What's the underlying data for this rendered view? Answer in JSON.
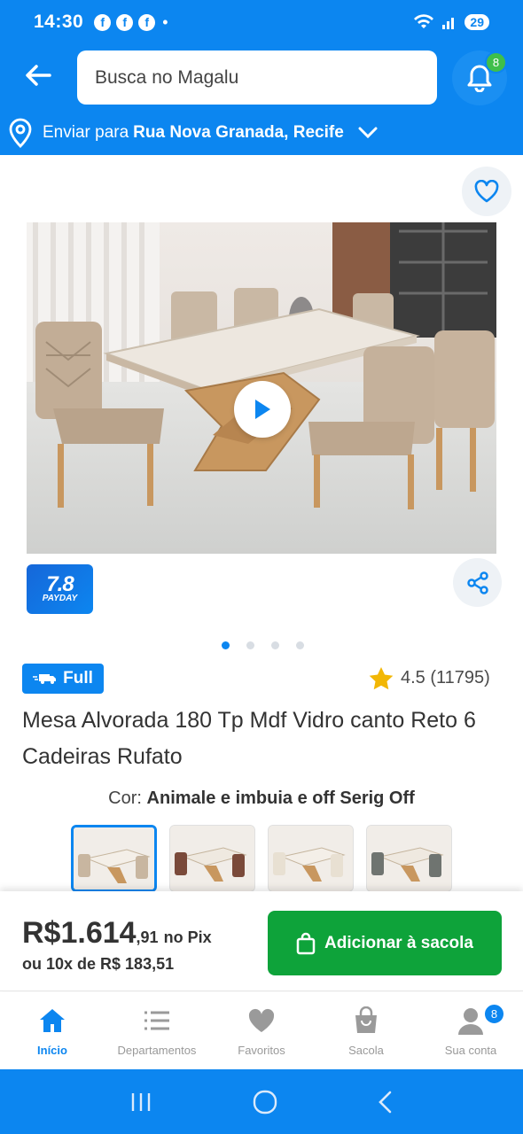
{
  "status_bar": {
    "time": "14:30",
    "battery": "29"
  },
  "header": {
    "search_placeholder": "Busca no Magalu",
    "notification_count": "8"
  },
  "address": {
    "prefix": "Enviar para",
    "location": "Rua Nova Granada, Recife"
  },
  "product": {
    "badge_payday_big": "7.8",
    "badge_payday_small": "PAYDAY",
    "carousel_total": 4,
    "carousel_active": 1,
    "shipping_badge": "Full",
    "rating": "4.5 (11795)",
    "title": "Mesa Alvorada 180 Tp Mdf Vidro canto Reto 6 Cadeiras Rufato",
    "color_label": "Cor:",
    "color_value": "Animale e imbuia e off Serig Off"
  },
  "price": {
    "main": "R$1.614",
    "cents": ",91",
    "method": "no Pix",
    "installments": "ou 10x de R$ 183,51"
  },
  "cart_button": "Adicionar à sacola",
  "bottom_nav": {
    "home": "Início",
    "departments": "Departamentos",
    "favorites": "Favoritos",
    "bag": "Sacola",
    "account": "Sua conta",
    "account_badge": "8"
  },
  "colors": {
    "brand_blue": "#0c86f0",
    "buy_green": "#0ea33a"
  }
}
